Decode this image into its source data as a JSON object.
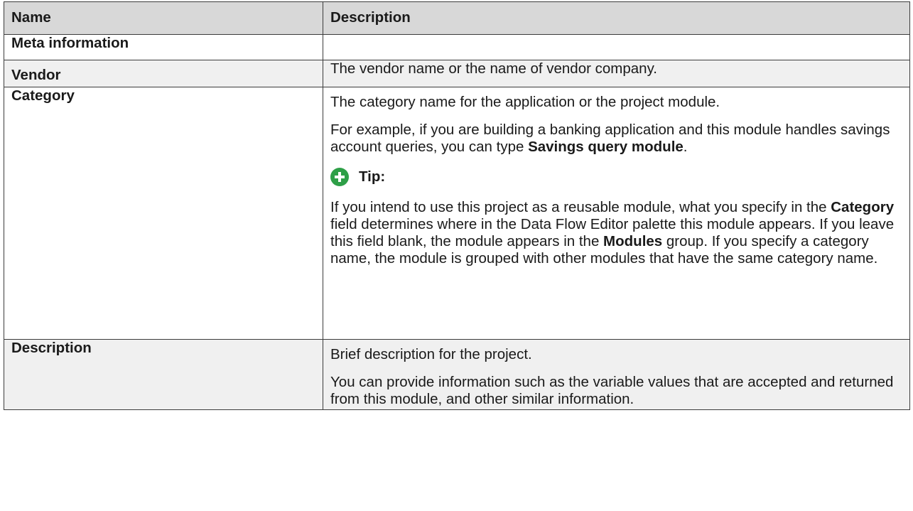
{
  "table": {
    "headers": [
      "Name",
      "Description"
    ],
    "rows": {
      "meta": {
        "name": "Meta information"
      },
      "vendor": {
        "name": "Vendor",
        "description": "The vendor name or the name of vendor company."
      },
      "category": {
        "name": "Category",
        "p1": "The category name for the application or the project module.",
        "p2_a": "For example, if you are building a banking application and this module handles savings account queries, you can type ",
        "p2_bold": "Savings query module",
        "p2_b": ".",
        "tip_label": "Tip:",
        "tip_icon": "plus-circle-icon",
        "tip_color": "#2e9f47",
        "tip_a": "If you intend to use this project as a reusable module, what you specify in the ",
        "tip_bold1": "Category",
        "tip_b": " field determines where in the Data Flow Editor palette this module appears. If you leave this field blank, the module appears in the ",
        "tip_bold2": "Modules",
        "tip_c": " group. If you specify a category name, the module is grouped with other modules that have the same category name."
      },
      "description": {
        "name": "Description",
        "p1": "Brief description for the project.",
        "p2": "You can provide information such as the variable values that are accepted and returned from this module, and other similar information."
      }
    }
  }
}
